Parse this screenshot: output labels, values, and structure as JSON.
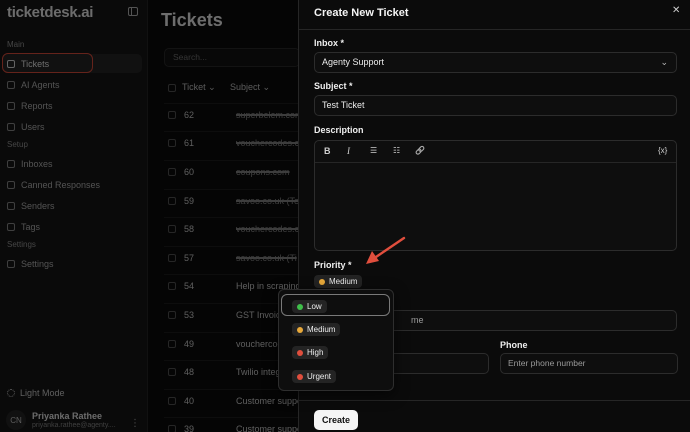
{
  "sidebar": {
    "brand": "ticketdesk.ai",
    "sections": {
      "main": "Main",
      "setup": "Setup",
      "settings": "Settings"
    },
    "items": [
      {
        "label": "Tickets",
        "icon": "inbox-icon"
      },
      {
        "label": "AI Agents",
        "icon": "sparkles-icon"
      },
      {
        "label": "Reports",
        "icon": "bar-chart-icon"
      },
      {
        "label": "Users",
        "icon": "users-icon"
      },
      {
        "label": "Inboxes",
        "icon": "mail-icon"
      },
      {
        "label": "Canned Responses",
        "icon": "message-icon"
      },
      {
        "label": "Senders",
        "icon": "send-icon"
      },
      {
        "label": "Tags",
        "icon": "tag-icon"
      },
      {
        "label": "Settings",
        "icon": "gear-icon"
      }
    ],
    "light_mode": "Light Mode",
    "user": {
      "initials": "CN",
      "name": "Priyanka Rathee",
      "email": "priyanka.rathee@agenty...."
    }
  },
  "main": {
    "title": "Tickets",
    "search_placeholder": "Search...",
    "columns": {
      "ticket": "Ticket ⌄",
      "subject": "Subject ⌄"
    },
    "rows": [
      {
        "id": "62",
        "subject": "superbelem.com"
      },
      {
        "id": "61",
        "subject": "vouchercodes.co"
      },
      {
        "id": "60",
        "subject": "coupons.com"
      },
      {
        "id": "59",
        "subject": "savoo.co.uk (Ten"
      },
      {
        "id": "58",
        "subject": "vouchercodes.co"
      },
      {
        "id": "57",
        "subject": "savoo.co.uk (Ti"
      },
      {
        "id": "54",
        "subject": "Help in scraping"
      },
      {
        "id": "53",
        "subject": "GST Invoice"
      },
      {
        "id": "49",
        "subject": "vouchercodes"
      },
      {
        "id": "48",
        "subject": "Twilio integ"
      },
      {
        "id": "40",
        "subject": "Customer suppo"
      },
      {
        "id": "39",
        "subject": "Customer suppo"
      }
    ]
  },
  "sheet": {
    "title": "Create New Ticket",
    "inbox_label": "Inbox *",
    "inbox_value": "Agenty Support",
    "subject_label": "Subject *",
    "subject_value": "Test Ticket",
    "description_label": "Description",
    "toolbar": {
      "bold": "B",
      "italic": "I",
      "bullet": "☰",
      "ordered": "☷",
      "link": "🔗",
      "variable": "{x}"
    },
    "priority_label": "Priority *",
    "priority_value": "Medium",
    "name_placeholder_tail": "me",
    "phone_label": "Phone",
    "phone_placeholder": "Enter phone number",
    "create_label": "Create",
    "close": "✕"
  },
  "priority_dropdown": {
    "options": [
      {
        "label": "Low",
        "color": "#3fbf4a"
      },
      {
        "label": "Medium",
        "color": "#e8a93a"
      },
      {
        "label": "High",
        "color": "#e04e3d"
      },
      {
        "label": "Urgent",
        "color": "#e04e3d"
      }
    ]
  },
  "colors": {
    "highlight": "#e04e3d"
  }
}
